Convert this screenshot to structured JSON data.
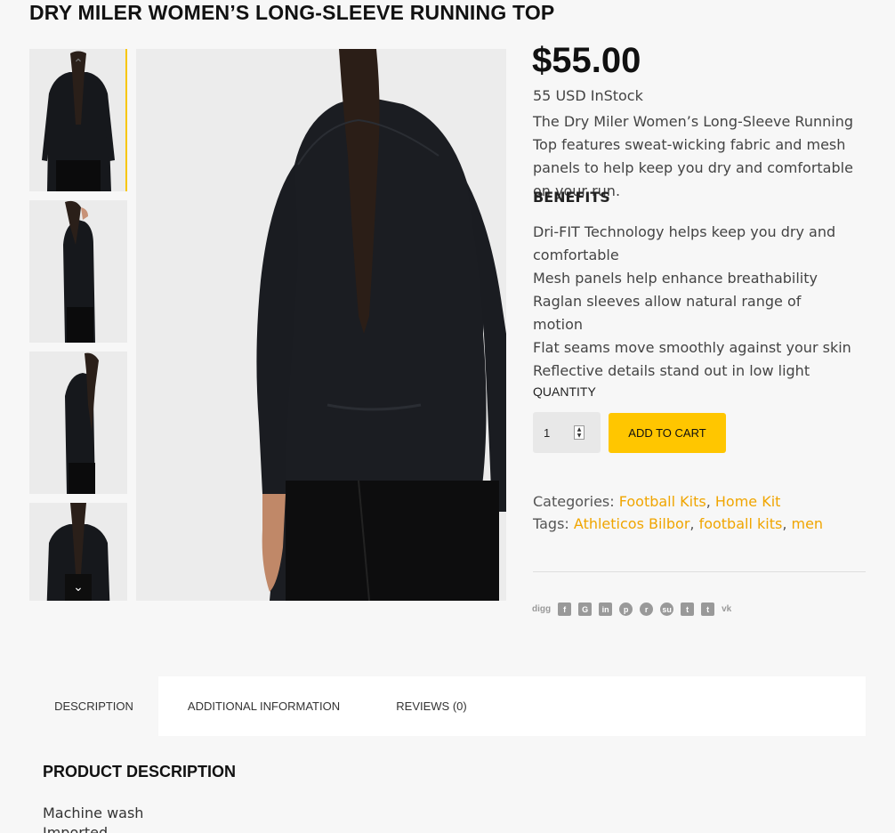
{
  "product": {
    "title": "DRY MILER WOMEN’S LONG-SLEEVE RUNNING TOP",
    "price": "$55.00",
    "stock": "55 USD InStock",
    "description": "The Dry Miler Women’s Long-Sleeve Running Top features sweat-wicking fabric and mesh panels to help keep you dry and comfortable on your run.",
    "benefits_heading": "BENEFITS",
    "benefits": [
      "Dri-FIT Technology helps keep you dry and comfortable",
      "Mesh panels help enhance breathability",
      "Raglan sleeves allow natural range of motion",
      "Flat seams move smoothly against your skin",
      "Reflective details stand out in low light"
    ]
  },
  "cart": {
    "quantity_label": "QUANTITY",
    "quantity_value": "1",
    "add_to_cart_label": "ADD TO CART"
  },
  "meta": {
    "categories_label": "Categories:",
    "categories": [
      "Football Kits",
      "Home Kit"
    ],
    "tags_label": "Tags:",
    "tags": [
      "Athleticos Bilbor",
      "football kits",
      "men"
    ]
  },
  "share": {
    "icons": [
      "digg-icon",
      "facebook-icon",
      "google-plus-icon",
      "linkedin-icon",
      "pinterest-icon",
      "reddit-icon",
      "stumbleupon-icon",
      "tumblr-icon",
      "twitter-icon",
      "vk-icon"
    ],
    "digg_text": "digg"
  },
  "tabs": {
    "items": [
      "DESCRIPTION",
      "ADDITIONAL INFORMATION",
      "REVIEWS (0)"
    ],
    "active": "DESCRIPTION"
  },
  "description_panel": {
    "heading": "PRODUCT DESCRIPTION",
    "lines": [
      "Machine wash",
      "Imported"
    ]
  },
  "colors": {
    "accent": "#ffc600",
    "link": "#f0a500",
    "background": "#f7f7f7"
  }
}
